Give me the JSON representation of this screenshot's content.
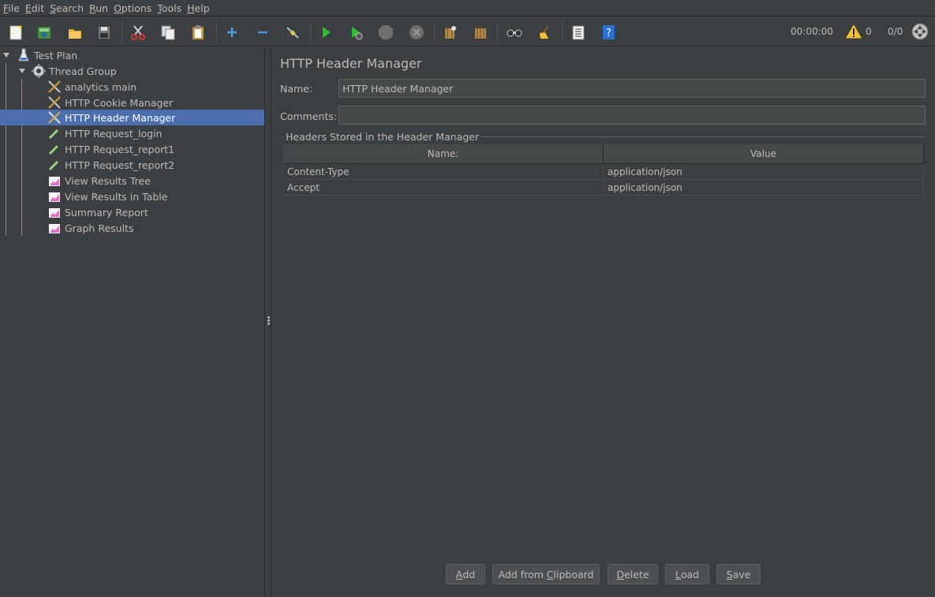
{
  "menu": [
    {
      "mnemonic": "F",
      "rest": "ile"
    },
    {
      "mnemonic": "E",
      "rest": "dit"
    },
    {
      "mnemonic": "S",
      "rest": "earch"
    },
    {
      "mnemonic": "R",
      "rest": "un"
    },
    {
      "mnemonic": "O",
      "rest": "ptions"
    },
    {
      "mnemonic": "T",
      "rest": "ools"
    },
    {
      "mnemonic": "H",
      "rest": "elp"
    }
  ],
  "toolbar": {
    "timer": "00:00:00",
    "warning_count": "0",
    "thread_ratio": "0/0"
  },
  "tree": {
    "root": "Test Plan",
    "thread_group": "Thread Group",
    "items": [
      {
        "label": "analytics main",
        "icon": "wrench-icon"
      },
      {
        "label": "HTTP Cookie Manager",
        "icon": "wrench-icon"
      },
      {
        "label": "HTTP Header Manager",
        "icon": "wrench-icon",
        "selected": true
      },
      {
        "label": "HTTP Request_login",
        "icon": "pipette-icon"
      },
      {
        "label": "HTTP Request_report1",
        "icon": "pipette-icon"
      },
      {
        "label": "HTTP Request_report2",
        "icon": "pipette-icon"
      },
      {
        "label": "View Results Tree",
        "icon": "graph-icon"
      },
      {
        "label": "View Results in Table",
        "icon": "graph-icon"
      },
      {
        "label": "Summary Report",
        "icon": "graph-icon"
      },
      {
        "label": "Graph Results",
        "icon": "graph-icon"
      }
    ]
  },
  "panel": {
    "title": "HTTP Header Manager",
    "name_label": "Name:",
    "name_value": "HTTP Header Manager",
    "comments_label": "Comments:",
    "comments_value": "",
    "group_title": "Headers Stored in the Header Manager",
    "columns": [
      "Name:",
      "Value"
    ],
    "rows": [
      {
        "name": "Content-Type",
        "value": "application/json"
      },
      {
        "name": "Accept",
        "value": "application/json"
      }
    ]
  },
  "buttons": {
    "add": {
      "mnemonic": "A",
      "rest": "dd"
    },
    "add_clipboard": {
      "pre": "Add from ",
      "mnemonic": "C",
      "rest": "lipboard"
    },
    "delete": {
      "mnemonic": "D",
      "rest": "elete"
    },
    "load": {
      "mnemonic": "L",
      "rest": "oad"
    },
    "save": {
      "mnemonic": "S",
      "rest": "ave"
    }
  },
  "colors": {
    "background": "#3c3f41",
    "selection": "#4b6eaf",
    "text": "#bbbbbb"
  }
}
